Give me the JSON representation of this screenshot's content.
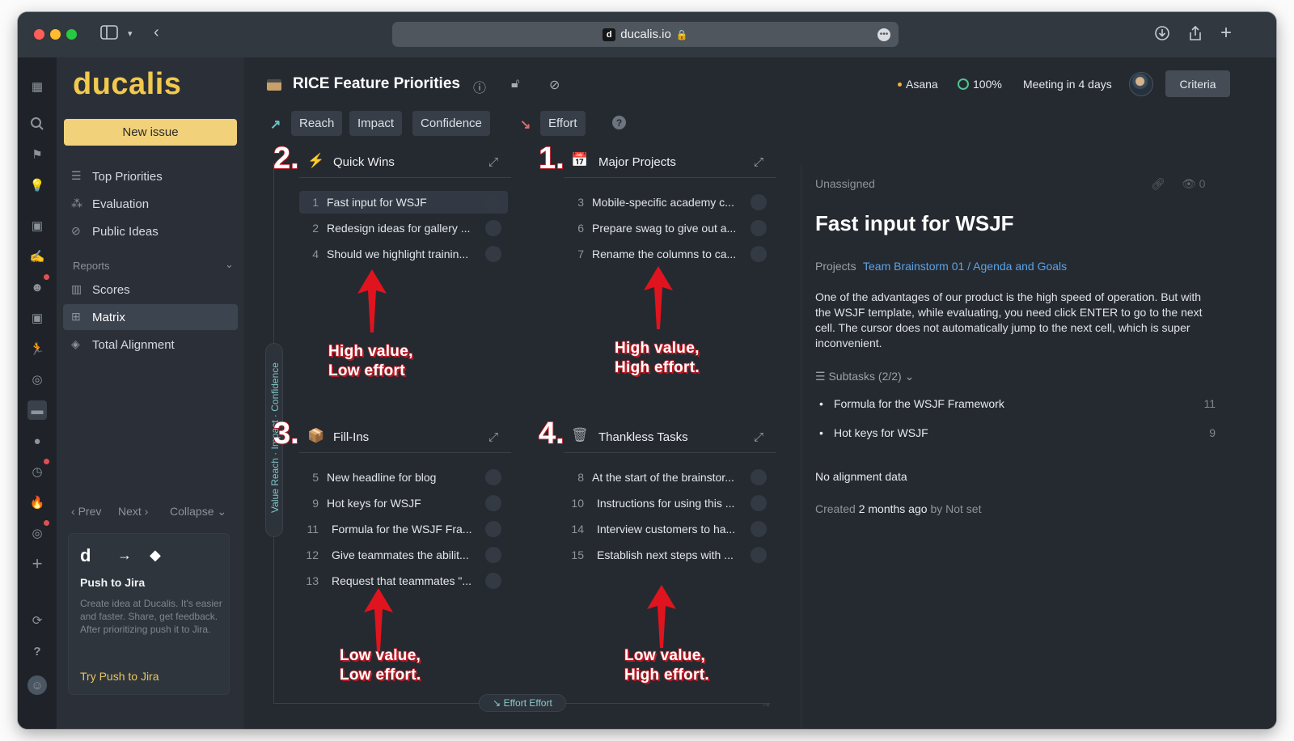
{
  "browser": {
    "url": "ducalis.io",
    "favicon_letter": "d"
  },
  "sidebar": {
    "logo": "ducalis",
    "new_issue": "New issue",
    "nav": [
      {
        "label": "Top Priorities",
        "icon": "list-icon"
      },
      {
        "label": "Evaluation",
        "icon": "evaluation-icon"
      },
      {
        "label": "Public Ideas",
        "icon": "public-ideas-icon"
      }
    ],
    "reports_label": "Reports",
    "reports": [
      {
        "label": "Scores",
        "icon": "scores-icon"
      },
      {
        "label": "Matrix",
        "icon": "matrix-icon",
        "active": true
      },
      {
        "label": "Total Alignment",
        "icon": "layers-icon"
      }
    ],
    "pager": {
      "prev": "Prev",
      "next": "Next",
      "collapse": "Collapse"
    },
    "promo": {
      "logo_letter": "d",
      "title": "Push to Jira",
      "text": "Create idea at Ducalis. It's easier and faster. Share, get feedback. After prioritizing push it to Jira.",
      "link": "Try Push to Jira"
    }
  },
  "header": {
    "title": "RICE Feature Priorities",
    "integration": "Asana",
    "progress": "100%",
    "meeting": "Meeting in 4 days",
    "criteria_button": "Criteria"
  },
  "criteria_bar": {
    "value_factors": [
      "Reach",
      "Impact",
      "Confidence"
    ],
    "effort_factors": [
      "Effort"
    ],
    "help": "?"
  },
  "axes": {
    "vertical": "Value Reach · Impact · Confidence",
    "horizontal": "Effort Effort"
  },
  "quadrants": [
    {
      "number": "2.",
      "title": "Quick Wins",
      "icon": "lightning-icon",
      "items": [
        {
          "num": "1",
          "text": "Fast input for WSJF",
          "selected": true
        },
        {
          "num": "2",
          "text": "Redesign ideas for gallery ..."
        },
        {
          "num": "4",
          "text": "Should we highlight trainin..."
        }
      ],
      "annotation": [
        "High value,",
        "Low effort"
      ]
    },
    {
      "number": "1.",
      "title": "Major Projects",
      "icon": "calendar-icon",
      "items": [
        {
          "num": "3",
          "text": "Mobile-specific academy c..."
        },
        {
          "num": "6",
          "text": "Prepare swag to give out a..."
        },
        {
          "num": "7",
          "text": "Rename the columns to ca..."
        }
      ],
      "annotation": [
        "High value,",
        "High effort."
      ]
    },
    {
      "number": "3.",
      "title": "Fill-Ins",
      "icon": "box-icon",
      "items": [
        {
          "num": "5",
          "text": "New headline for blog"
        },
        {
          "num": "9",
          "text": "Hot keys for WSJF"
        },
        {
          "num": "11",
          "text": "Formula for the WSJF Fra..."
        },
        {
          "num": "12",
          "text": "Give teammates the abilit..."
        },
        {
          "num": "13",
          "text": "Request that teammates \"..."
        }
      ],
      "annotation": [
        "Low value,",
        "Low effort."
      ]
    },
    {
      "number": "4.",
      "title": "Thankless Tasks",
      "icon": "trash-icon",
      "items": [
        {
          "num": "8",
          "text": "At the start of the brainstor..."
        },
        {
          "num": "10",
          "text": "Instructions for using this ..."
        },
        {
          "num": "14",
          "text": "Interview customers to ha..."
        },
        {
          "num": "15",
          "text": "Establish next steps with ..."
        }
      ],
      "annotation": [
        "Low value,",
        "High effort."
      ]
    }
  ],
  "detail": {
    "assignee": "Unassigned",
    "watchers": "0",
    "title": "Fast input for WSJF",
    "projects_label": "Projects",
    "projects_value": "Team Brainstorm 01 / Agenda and Goals",
    "description": "One of the advantages of our product is the high speed of operation. But with the WSJF template, while evaluating, you need click ENTER to go to the next cell. The cursor does not automatically jump to the next cell, which is super inconvenient.",
    "subtasks_label": "Subtasks (2/2)",
    "subtasks": [
      {
        "text": "Formula for the WSJF Framework",
        "num": "11"
      },
      {
        "text": "Hot keys for WSJF",
        "num": "9"
      }
    ],
    "alignment": "No alignment data",
    "created_prefix": "Created",
    "created_when": "2 months ago",
    "created_by_prefix": "by",
    "created_by": "Not set"
  },
  "colors": {
    "brand_yellow": "#f2c94c",
    "annotation_red": "#d21f2a",
    "link_blue": "#5aa3e6",
    "progress_green": "#4ec58d"
  }
}
